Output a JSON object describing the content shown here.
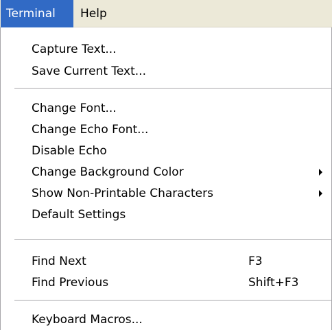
{
  "menubar": {
    "items": [
      {
        "label": "Terminal",
        "active": true
      },
      {
        "label": "Help",
        "active": false
      }
    ],
    "highlight_color": "#316ac5",
    "background_color": "#ece9d8"
  },
  "menu": {
    "items": [
      {
        "label": "Capture Text..."
      },
      {
        "label": "Save Current Text..."
      },
      {
        "label": "Change Font..."
      },
      {
        "label": "Change Echo Font..."
      },
      {
        "label": "Disable Echo"
      },
      {
        "label": "Change Background Color",
        "submenu_icon": "submenu-arrow-icon"
      },
      {
        "label": "Show Non-Printable Characters",
        "submenu_icon": "submenu-arrow-icon"
      },
      {
        "label": "Default Settings"
      },
      {
        "label": "Find Next",
        "shortcut": "F3"
      },
      {
        "label": "Find Previous",
        "shortcut": "Shift+F3"
      },
      {
        "label": "Keyboard Macros..."
      }
    ]
  }
}
